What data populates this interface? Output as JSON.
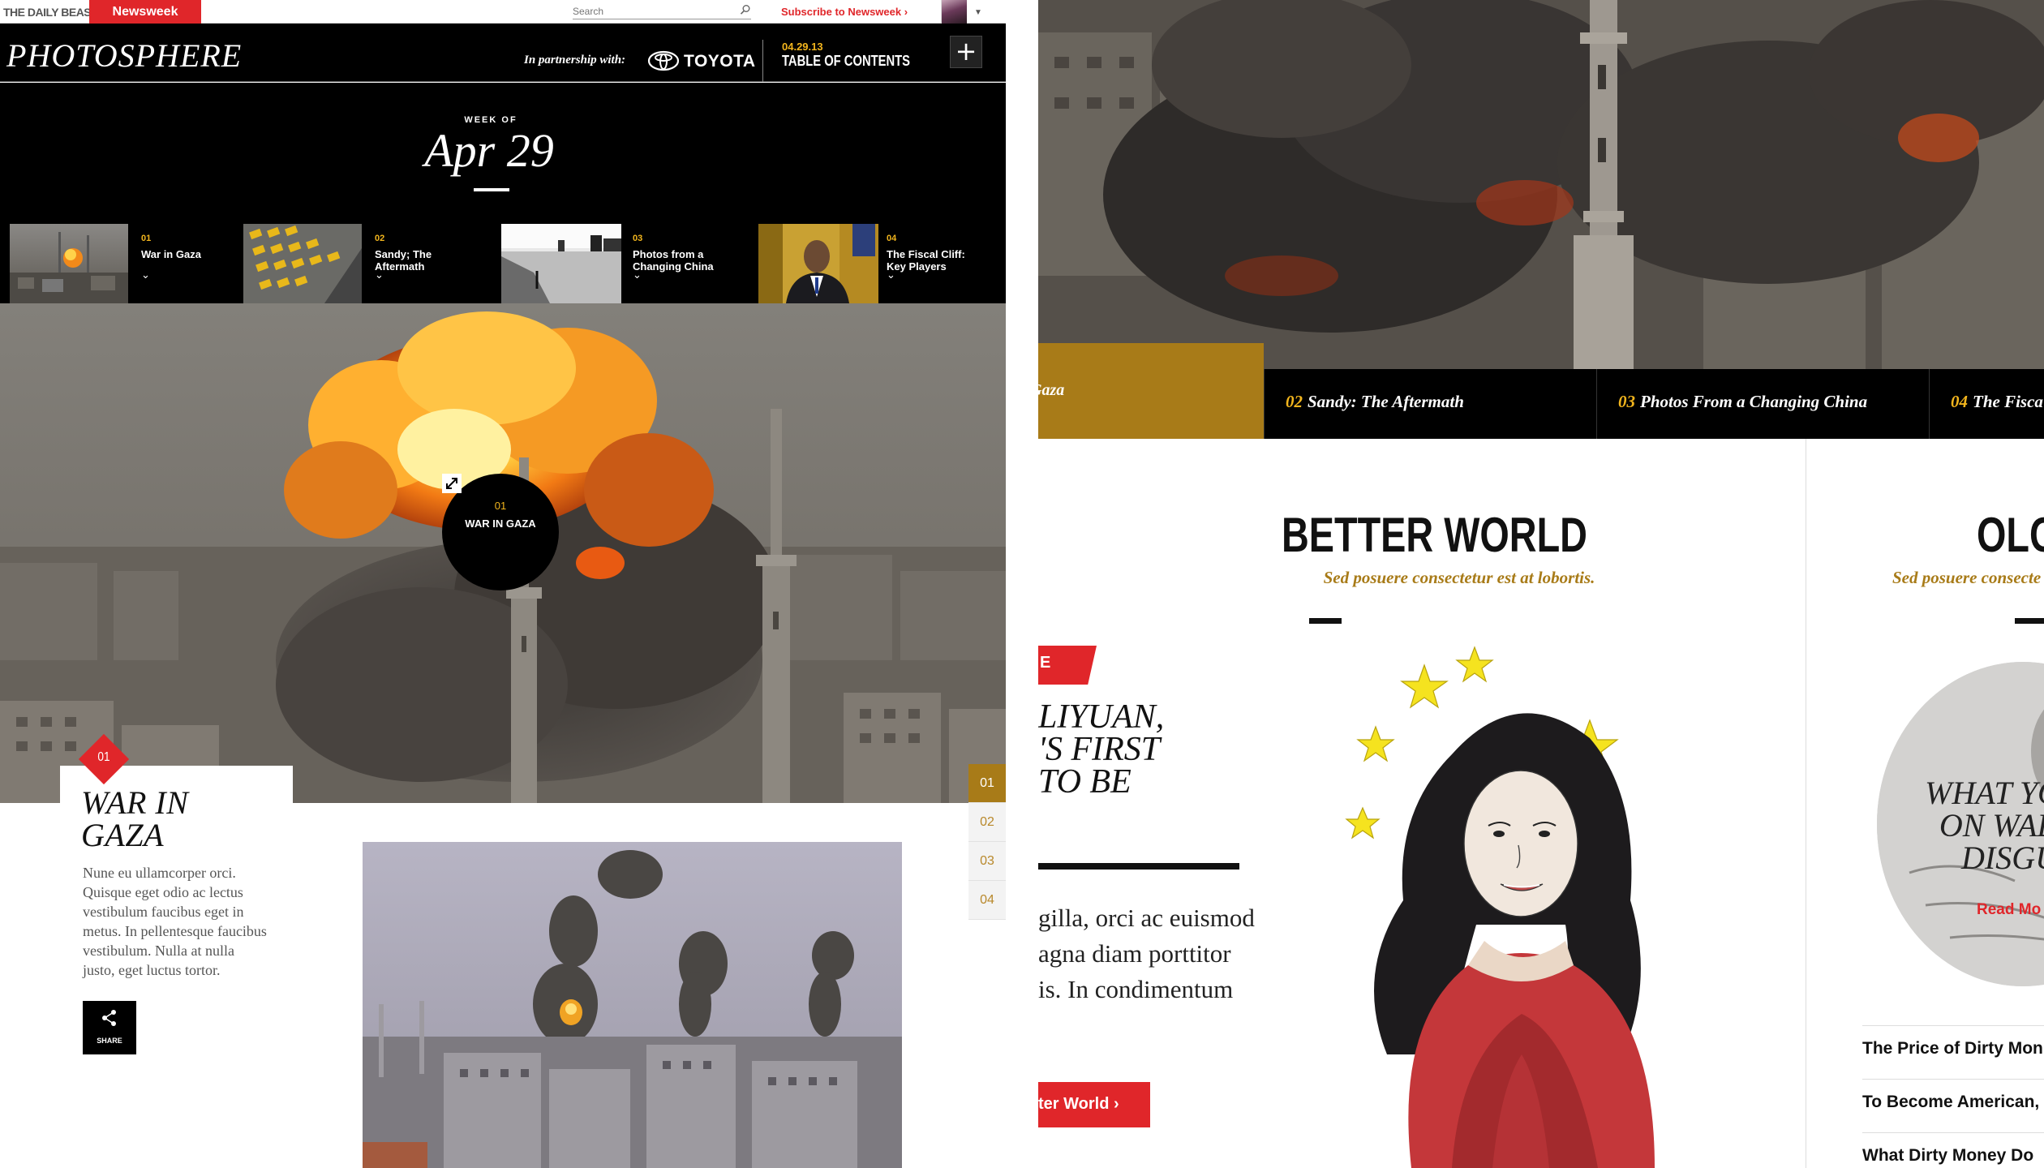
{
  "topbar": {
    "brand_dailybeast": "THE DAILY BEAST",
    "brand_newsweek": "Newsweek",
    "search_placeholder": "Search",
    "subscribe": "Subscribe to Newsweek ›"
  },
  "header": {
    "title": "PHOTOSPHERE",
    "partnership": "In partnership with:",
    "partner": "TOYOTA",
    "toc_date": "04.29.13",
    "toc_label": "TABLE OF CONTENTS",
    "plus": "+"
  },
  "week": {
    "label": "WEEK OF",
    "date": "Apr 29"
  },
  "strip": [
    {
      "num": "01",
      "title": "War in Gaza"
    },
    {
      "num": "02",
      "title": "Sandy; The Aftermath"
    },
    {
      "num": "03",
      "title": "Photos from a Changing China"
    },
    {
      "num": "04",
      "title": "The Fiscal Cliff: Key Players"
    }
  ],
  "hero": {
    "badge_num": "01",
    "badge_title": "WAR IN GAZA"
  },
  "story": {
    "num": "01",
    "title": "WAR IN GAZA",
    "body": "Nune eu ullamcorper orci. Quisque eget odio ac lectus vestibulum faucibus eget in metus. In pellentesque faucibus vestibulum. Nulla at nulla justo, eget luctus tortor.",
    "share": "SHARE"
  },
  "pager": [
    "01",
    "02",
    "03",
    "04"
  ],
  "right": {
    "active_tab": "Gaza",
    "tabs": [
      {
        "num": "02",
        "label": "Sandy: The Aftermath"
      },
      {
        "num": "03",
        "label": "Photos From a Changing China"
      },
      {
        "num": "04",
        "label": "The Fisca"
      }
    ],
    "section_title": "BETTER WORLD",
    "section_sub": "Sed posuere consectetur est at lobortis.",
    "tag_letter": "E",
    "feature_title": "LIYUAN,\n'S FIRST\nTO BE",
    "feature_body": "gilla, orci ac euismod\nagna diam porttitor\nis. In condimentum",
    "feature_button": "ter World ›",
    "col2_title": "OLO",
    "col2_sub": "Sed posuere consecte",
    "col2_headline": "WHAT YOU'R\nON WALL S\nDISGUS",
    "col2_readmore": "Read Mo",
    "col2_links": [
      "The Price of Dirty Mon",
      "To Become American,",
      "What Dirty Money Do"
    ]
  },
  "colors": {
    "accent_red": "#e0262a",
    "accent_gold": "#a87b18",
    "highlight_yellow": "#f2b51d"
  }
}
